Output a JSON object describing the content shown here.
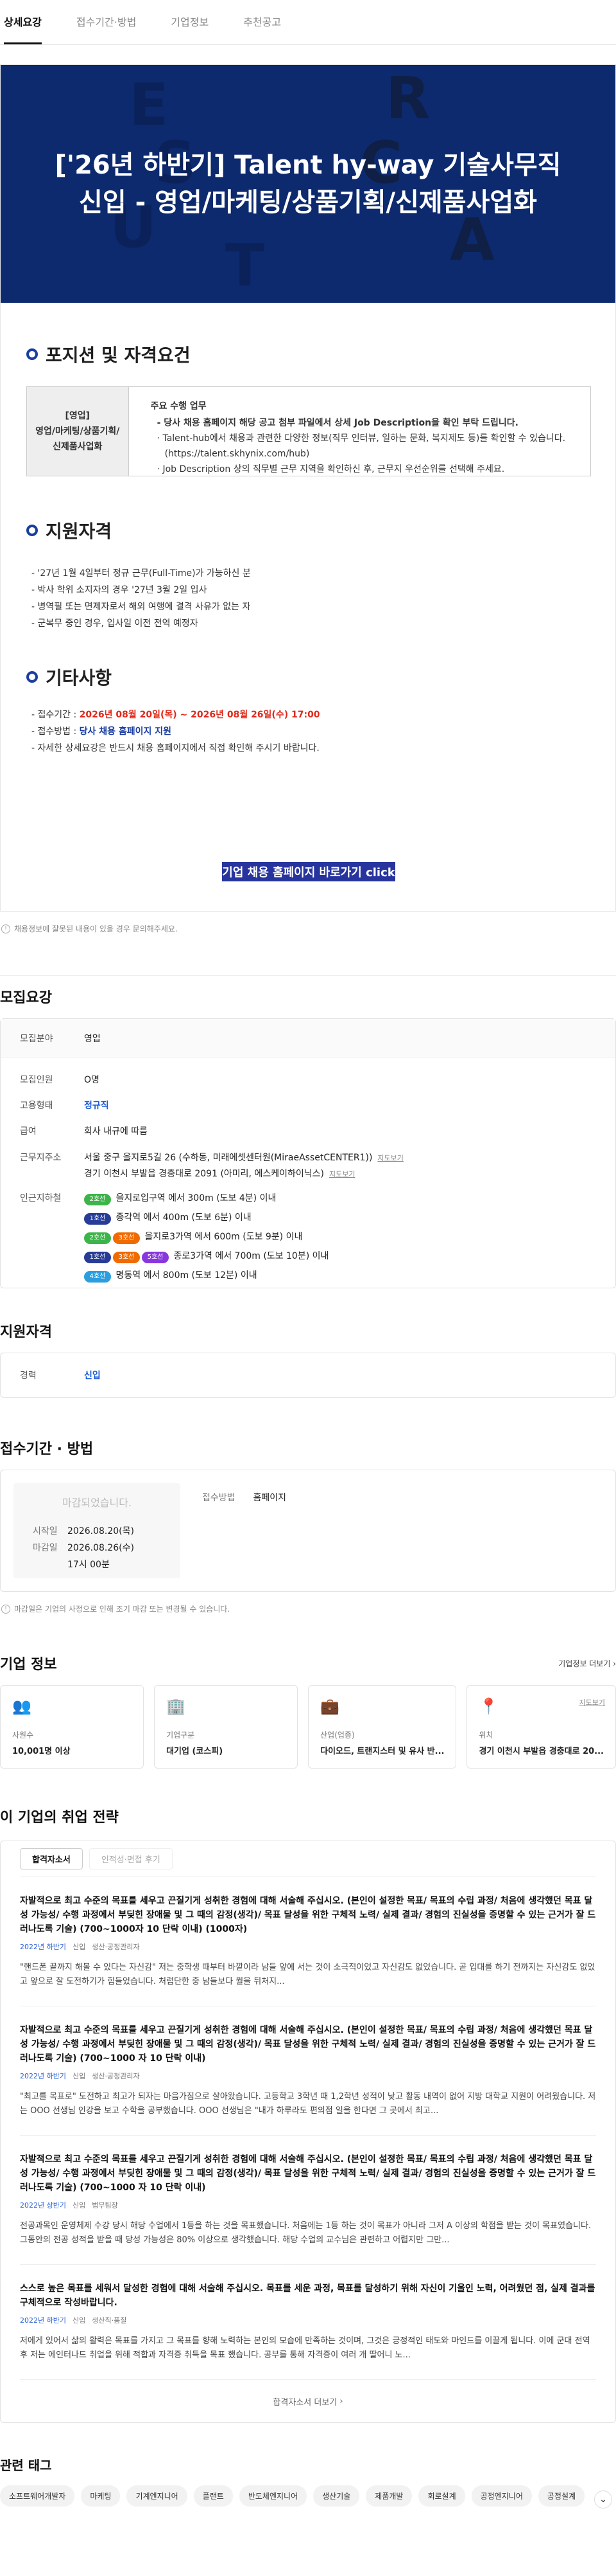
{
  "tabs": [
    "상세요강",
    "접수기간·방법",
    "기업정보",
    "추천공고"
  ],
  "banner": {
    "title_line1": "['26년 하반기] Talent hy-way 기술사무직",
    "title_line2": "신입 - 영업/마케팅/상품기획/신제품사업화"
  },
  "position": {
    "section_title": "포지션 및 자격요건",
    "role_line1": "[영업]",
    "role_line2": "영업/마케팅/상품기획/",
    "role_line3": "신제품사업화",
    "duties_header": "주요 수행 업무",
    "duties_bold": "- 당사 채용 홈페이지 해당 공고 첨부 파일에서 상세 Job Description을 확인 부탁 드립니다.",
    "duties_1": "· Talent-hub에서 채용과 관련한 다양한 정보(직무 인터뷰, 일하는 문화, 복지제도 등)를 확인할 수 있습니다.(https://talent.skhynix.com/hub)",
    "duties_2": "· Job Description 상의 직무별 근무 지역을 확인하신 후, 근무지 우선순위를 선택해 주세요."
  },
  "qualification": {
    "section_title": "지원자격",
    "lines": [
      "- '27년 1월 4일부터 정규 근무(Full-Time)가 가능하신 분",
      "- 박사 학위 소지자의 경우 '27년 3월 2일 입사",
      "- 병역필 또는 면제자로서 해외 여행에 결격 사유가 없는 자",
      "- 군복무 중인 경우, 입사일 이전 전역 예정자"
    ]
  },
  "etc": {
    "section_title": "기타사항",
    "period_label": "- 접수기간 : ",
    "period_value": "2026년 08월 20일(목) ~ 2026년 08월 26일(수) 17:00",
    "method_label": "- 접수방법 : ",
    "method_value": "당사 채용 홈페이지 지원",
    "note": "- 자세한 상세요강은 반드시 채용 홈페이지에서 직접 확인해 주시기 바랍니다."
  },
  "cta_label": "기업 채용 홈페이지 바로가기 click",
  "notice_text": "채용정보에 잘못된 내용이 있을 경우 문의해주세요.",
  "summary": {
    "title": "모집요강",
    "field_k": "모집분야",
    "field_v": "영업",
    "count_k": "모집인원",
    "count_v": "O명",
    "type_k": "고용형태",
    "type_v": "정규직",
    "pay_k": "급여",
    "pay_v": "회사 내규에 따름",
    "loc_k": "근무지주소",
    "loc_1": "서울 중구 을지로5길 26 (수하동, 미래에셋센터원(MiraeAssetCENTER1))",
    "loc_2": "경기 이천시 부발읍 경충대로 2091 (아미리, 에스케이하이닉스)",
    "map_link": "지도보기",
    "station_k": "인근지하철",
    "stations": [
      {
        "badges": [
          {
            "t": "2호선",
            "c": "#3db449"
          }
        ],
        "text": "을지로입구역 에서 300m (도보 4분) 이내"
      },
      {
        "badges": [
          {
            "t": "1호선",
            "c": "#263c96"
          }
        ],
        "text": "종각역 에서 400m (도보 6분) 이내"
      },
      {
        "badges": [
          {
            "t": "2호선",
            "c": "#3db449"
          },
          {
            "t": "3호선",
            "c": "#f06a00"
          }
        ],
        "text": "을지로3가역 에서 600m (도보 9분) 이내"
      },
      {
        "badges": [
          {
            "t": "1호선",
            "c": "#263c96"
          },
          {
            "t": "3호선",
            "c": "#f06a00"
          },
          {
            "t": "5호선",
            "c": "#8936e0"
          }
        ],
        "text": "종로3가역 에서 700m (도보 10분) 이내"
      },
      {
        "badges": [
          {
            "t": "4호선",
            "c": "#2c9ede"
          }
        ],
        "text": "명동역 에서 800m (도보 12분) 이내"
      }
    ]
  },
  "qual2": {
    "title": "지원자격",
    "k": "경력",
    "v": "신입"
  },
  "period": {
    "title": "접수기간 · 방법",
    "closed": "마감되었습니다.",
    "start_k": "시작일",
    "start_v": "2026.08.20(목)",
    "end_k": "마감일",
    "end_v1": "2026.08.26(수)",
    "end_v2": "17시 00분",
    "method_k": "접수방법",
    "method_v": "홈페이지",
    "notice": "마감일은 기업의 사정으로 인해 조기 마감 또는 변경될 수 있습니다."
  },
  "company": {
    "title": "기업 정보",
    "more": "기업정보 더보기",
    "stats": [
      {
        "k": "사원수",
        "v": "10,001명 이상",
        "icon": "👥"
      },
      {
        "k": "기업구분",
        "v": "대기업 (코스피)",
        "icon": "🏢"
      },
      {
        "k": "산업(업종)",
        "v": "다이오드, 트랜지스터 및 유사 반...",
        "icon": "💼"
      },
      {
        "k": "위치",
        "v": "경기 이천시 부발읍 경충대로 20...",
        "icon": "📍",
        "link": "지도보기"
      }
    ]
  },
  "strategy": {
    "title": "이 기업의 취업 전략",
    "tab1": "합격자소서",
    "tab2": "인적성·면접 후기",
    "items": [
      {
        "q": "자발적으로 최고 수준의 목표를 세우고 끈질기게 성취한 경험에 대해 서술해 주십시오. (본인이 설정한 목표/ 목표의 수립 과정/ 처음에 생각했던 목표 달성 가능성/ 수행 과정에서 부딪힌 장애물 및 그 때의 감정(생각)/ 목표 달성을 위한 구체적 노력/ 실제 결과/ 경험의 진실성을 증명할 수 있는 근거가 잘 드러나도록 기술) (700~1000자 10 단락 이내) (1000자)",
        "year": "2022년 하반기",
        "lv": "신입",
        "job": "생산·공정관리자",
        "a": "\"핸드폰 끝까지 해볼 수 있다는 자신감\" 저는 중학생 때부터 바깥이라 남들 앞에 서는 것이 소극적이었고 자신감도 없었습니다. 곧 입대를 하기 전까지는 자신감도 없었고 앞으로 잘 도전하기가 힘들었습니다. 처럼단한 중 남들보다 월을 뒤처지..."
      },
      {
        "q": "자발적으로 최고 수준의 목표를 세우고 끈질기게 성취한 경험에 대해 서술해 주십시오. (본인이 설정한 목표/ 목표의 수립 과정/ 처음에 생각했던 목표 달성 가능성/ 수행 과정에서 부딪힌 장애물 및 그 때의 감정(생각)/ 목표 달성을 위한 구체적 노력/ 실제 결과/ 경험의 진실성을 증명할 수 있는 근거가 잘 드러나도록 기술) (700~1000 자 10 단락 이내)",
        "year": "2022년 하반기",
        "lv": "신입",
        "job": "생산·공정관리자",
        "a": "\"최고를 목표로\" 도전하고 최고가 되자는 마음가짐으로 살아왔습니다. 고등학교 3학년 때 1,2학년 성적이 낮고 활동 내역이 없어 지방 대학교 지원이 어려웠습니다. 저는 OOO 선생님 인강을 보고 수학을 공부했습니다. OOO 선생님은 \"내가 하루라도 편의점 일을 한다면 그 곳에서 최고..."
      },
      {
        "q": "자발적으로 최고 수준의 목표를 세우고 끈질기게 성취한 경험에 대해 서술해 주십시오. (본인이 설정한 목표/ 목표의 수립 과정/ 처음에 생각했던 목표 달성 가능성/ 수행 과정에서 부딪힌 장애물 및 그 때의 감정(생각)/ 목표 달성을 위한 구체적 노력/ 실제 결과/ 경험의 진실성을 증명할 수 있는 근거가 잘 드러나도록 기술) (700~1000 자 10 단락 이내)",
        "year": "2022년 상반기",
        "lv": "신입",
        "job": "법무팀장",
        "a": "전공과목인 운영체제 수강 당시 해당 수업에서 1등을 하는 것을 목표했습니다. 처음에는 1등 하는 것이 목표가 아니라 그저 A 이상의 학점을 받는 것이 목표였습니다. 그동안의 전공 성적을 받을 때 당성 가능성은 80% 이상으로 생각했습니다. 해당 수업의 교수님은 관련하고 어렵지만 그만..."
      },
      {
        "q": "스스로 높은 목표를 세워서 달성한 경험에 대해 서술해 주십시오. 목표를 세운 과정, 목표를 달성하기 위해 자신이 기울인 노력, 어려웠던 점, 실제 결과를 구체적으로 작성바랍니다.",
        "year": "2022년 하반기",
        "lv": "신입",
        "job": "생산직·품질",
        "a": "저에게 있어서 삶의 활력은 목표를 가지고 그 목표를 향해 노력하는 본인의 모습에 만족하는 것이며, 그것은 긍정적인 태도와 마인드를 이끌게 됩니다. 이에 군대 전역 후 저는 에인터나드 취업을 위해 적합과 자격증 취득을 목표 했습니다. 공부를 통해 자격증이 여러 개 딸어니 노..."
      }
    ],
    "more": "합격자소서 더보기"
  },
  "tags": {
    "title": "관련 태그",
    "list": [
      "소프트웨어개발자",
      "마케팅",
      "기계엔지니어",
      "플랜트",
      "반도체엔지니어",
      "생산기술",
      "제품개발",
      "회로설계",
      "공정엔지니어",
      "공정설계"
    ]
  }
}
